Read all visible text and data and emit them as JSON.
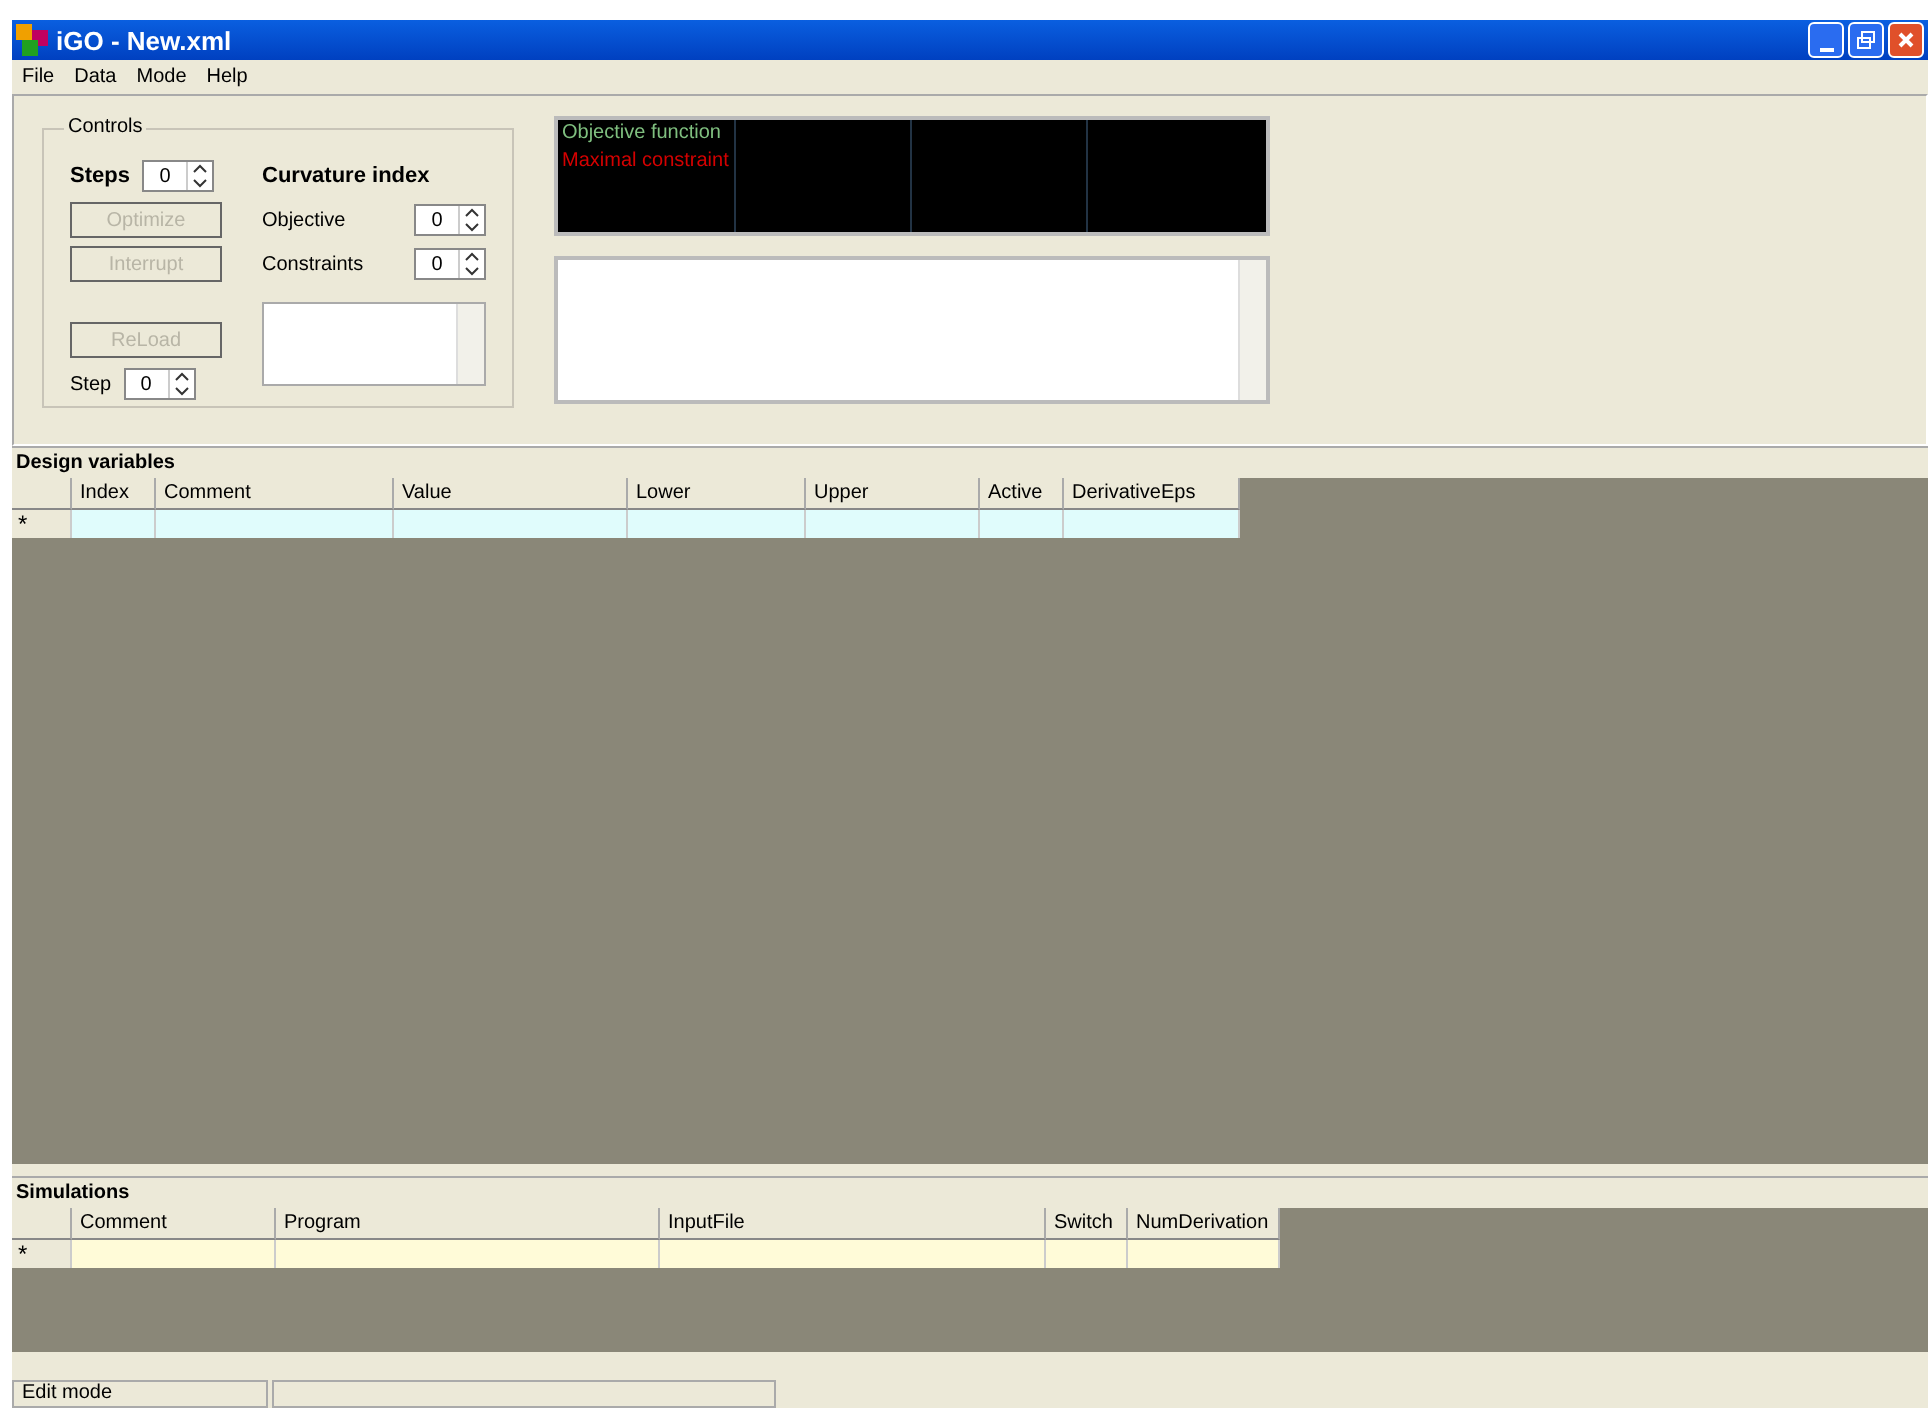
{
  "window": {
    "title": "iGO - New.xml"
  },
  "menu": [
    "File",
    "Data",
    "Mode",
    "Help"
  ],
  "controls": {
    "title": "Controls",
    "steps": {
      "label": "Steps",
      "value": "0"
    },
    "buttons": [
      {
        "label": "Optimize",
        "disabled": true
      },
      {
        "label": "Interrupt",
        "disabled": true
      },
      {
        "label": "ReLoad",
        "disabled": true
      }
    ],
    "step": {
      "label": "Step",
      "value": "0"
    },
    "curvature": {
      "title": "Curvature index",
      "objective": {
        "label": "Objective",
        "value": "0"
      },
      "constraints": {
        "label": "Constraints",
        "value": "0"
      }
    }
  },
  "legend": [
    {
      "label": "Objective function",
      "color": "#7fbf7f"
    },
    {
      "label": "Maximal constraint",
      "color": "#d40000"
    }
  ],
  "design_variables": {
    "title": "Design variables",
    "columns": [
      "Index",
      "Comment",
      "Value",
      "Lower",
      "Upper",
      "Active",
      "DerivativeEps"
    ],
    "new_row_marker": "*"
  },
  "simulations": {
    "title": "Simulations",
    "columns": [
      "Comment",
      "Program",
      "InputFile",
      "Switch",
      "NumDerivation"
    ],
    "new_row_marker": "*"
  },
  "status_bar": [
    "Edit mode"
  ]
}
